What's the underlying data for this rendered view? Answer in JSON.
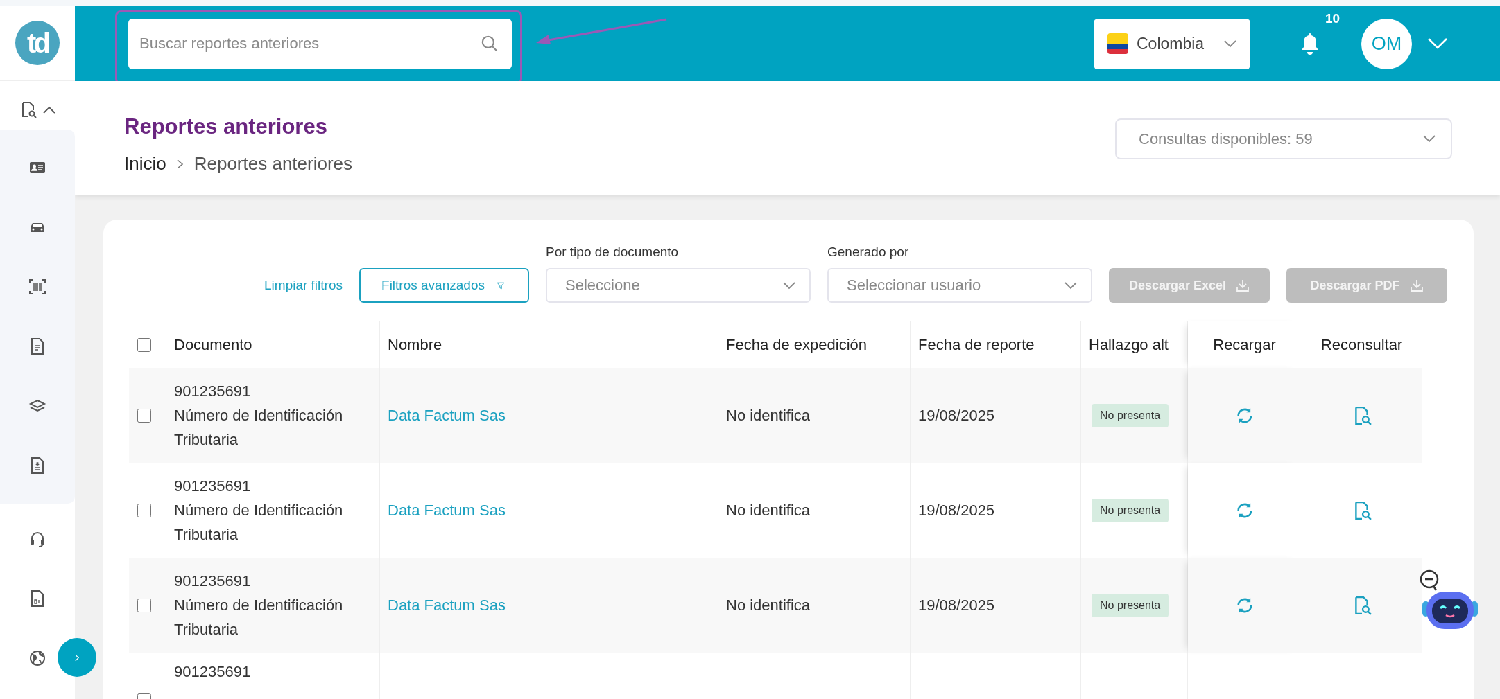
{
  "sidebar": {
    "logo": "td",
    "menu": {
      "expanded": true
    }
  },
  "header": {
    "search": {
      "placeholder": "Buscar reportes anteriores"
    },
    "country": "Colombia",
    "notifications": "10",
    "avatar": "OM"
  },
  "page": {
    "title": "Reportes anteriores",
    "breadcrumb": [
      "Inicio",
      "Reportes anteriores"
    ],
    "quota": "Consultas disponibles: 59"
  },
  "filters": {
    "clear": "Limpiar filtros",
    "advanced": "Filtros avanzados",
    "selects": [
      {
        "label": "Por tipo de documento",
        "placeholder": "Seleccione"
      },
      {
        "label": "Generado por",
        "placeholder": "Seleccionar usuario"
      }
    ],
    "downloads": [
      {
        "label": "Descargar Excel",
        "disabled": true
      },
      {
        "label": "Descargar PDF",
        "disabled": true
      }
    ]
  },
  "table": {
    "select_all": {
      "checked": false
    },
    "columns": [
      "Documento",
      "Nombre",
      "Fecha de expedición",
      "Fecha de reporte",
      "Hallazgo alt",
      "Recargar",
      "Reconsultar"
    ],
    "rows": [
      {
        "checked": false,
        "document_number": "901235691",
        "document_type": "Número de Identificación Tributaria",
        "name": "Data Factum Sas",
        "issued": "No identifica",
        "reported": "19/08/2025",
        "finding": "No presenta"
      },
      {
        "checked": false,
        "document_number": "901235691",
        "document_type": "Número de Identificación Tributaria",
        "name": "Data Factum Sas",
        "issued": "No identifica",
        "reported": "19/08/2025",
        "finding": "No presenta"
      },
      {
        "checked": false,
        "document_number": "901235691",
        "document_type": "Número de Identificación Tributaria",
        "name": "Data Factum Sas",
        "issued": "No identifica",
        "reported": "19/08/2025",
        "finding": "No presenta"
      },
      {
        "checked": false,
        "document_number": "901235691"
      }
    ]
  }
}
